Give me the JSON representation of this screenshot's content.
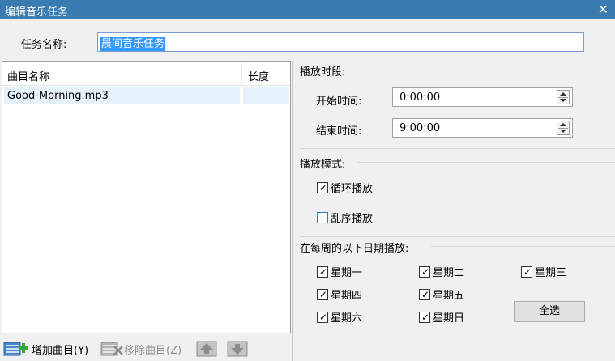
{
  "window": {
    "title": "编辑音乐任务",
    "close_glyph": "✕"
  },
  "task_name": {
    "label": "任务名称:",
    "value": "晨间音乐任务"
  },
  "track_list": {
    "headers": [
      "曲目名称",
      "长度"
    ],
    "rows": [
      {
        "name": "Good-Morning.mp3",
        "length": ""
      }
    ]
  },
  "toolbar": {
    "add_label": "增加曲目(Y)",
    "remove_label": "移除曲目(Z)",
    "add_icon": "add-track-icon",
    "remove_icon": "remove-track-icon",
    "move_up_icon": "move-up-icon",
    "move_down_icon": "move-down-icon"
  },
  "period": {
    "title": "播放时段:",
    "start_label": "开始时间:",
    "start_value": "0:00:00",
    "end_label": "结束时间:",
    "end_value": "9:00:00"
  },
  "mode": {
    "title": "播放模式:",
    "loop_label": "循环播放",
    "loop_checked": true,
    "shuffle_label": "乱序播放",
    "shuffle_checked": false
  },
  "days": {
    "title": "在每周的以下日期播放:",
    "items": [
      {
        "label": "星期一",
        "checked": true
      },
      {
        "label": "星期二",
        "checked": true
      },
      {
        "label": "星期三",
        "checked": true
      },
      {
        "label": "星期四",
        "checked": true
      },
      {
        "label": "星期五",
        "checked": true
      },
      {
        "label": "星期六",
        "checked": true
      },
      {
        "label": "星期日",
        "checked": true
      }
    ],
    "select_all_label": "全选"
  },
  "colors": {
    "titlebar": "#3a7bb0",
    "selection": "#3399ff",
    "row_highlight": "#e5f1fb"
  }
}
